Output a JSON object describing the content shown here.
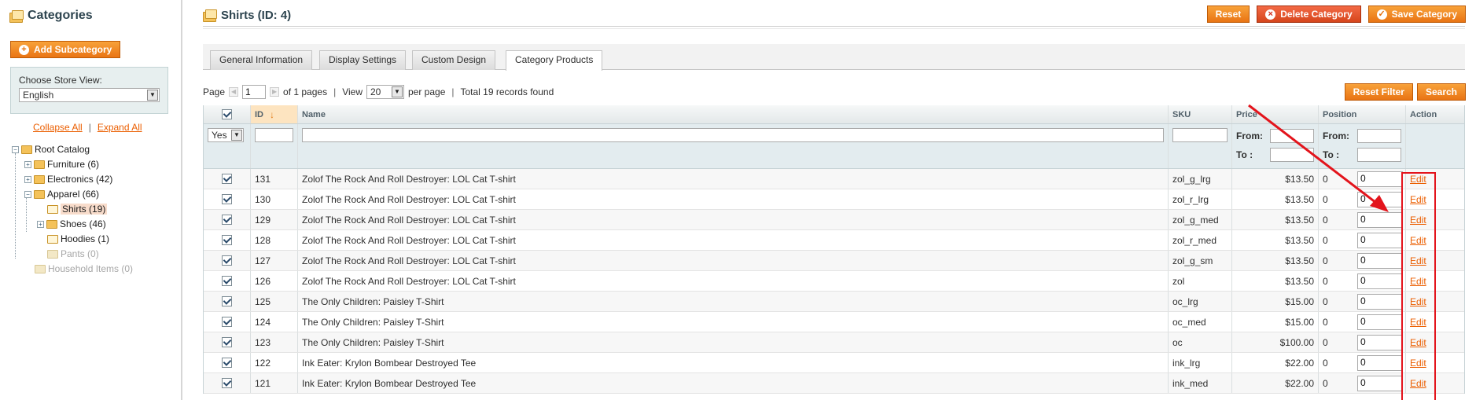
{
  "sidebar": {
    "title": "Categories",
    "add_subcategory": "Add Subcategory",
    "store_view_label": "Choose Store View:",
    "store_view_value": "English",
    "collapse_all": "Collapse All",
    "separator": "|",
    "expand_all": "Expand All",
    "tree": {
      "root": "Root Catalog",
      "furniture": "Furniture (6)",
      "electronics": "Electronics (42)",
      "apparel": "Apparel (66)",
      "shirts": "Shirts (19)",
      "shoes": "Shoes (46)",
      "hoodies": "Hoodies (1)",
      "pants": "Pants (0)",
      "household": "Household Items (0)"
    }
  },
  "header": {
    "title": "Shirts (ID: 4)",
    "reset": "Reset",
    "delete": "Delete Category",
    "save": "Save Category"
  },
  "tabs": [
    "General Information",
    "Display Settings",
    "Custom Design",
    "Category Products"
  ],
  "pager": {
    "page_label": "Page",
    "page_value": "1",
    "of_pages": "of 1 pages",
    "view_label": "View",
    "view_value": "20",
    "per_page": "per page",
    "total": "Total 19 records found",
    "reset_filter": "Reset Filter",
    "search": "Search"
  },
  "grid": {
    "headers": {
      "id": "ID",
      "name": "Name",
      "sku": "SKU",
      "price": "Price",
      "position": "Position",
      "action": "Action"
    },
    "filter": {
      "in_category": "Yes",
      "from": "From:",
      "to": "To :"
    },
    "rows": [
      {
        "id": "131",
        "name": "Zolof The Rock And Roll Destroyer: LOL Cat T-shirt",
        "sku": "zol_g_lrg",
        "price": "$13.50",
        "position": "0",
        "pos_input": "0",
        "action": "Edit"
      },
      {
        "id": "130",
        "name": "Zolof The Rock And Roll Destroyer: LOL Cat T-shirt",
        "sku": "zol_r_lrg",
        "price": "$13.50",
        "position": "0",
        "pos_input": "0",
        "action": "Edit"
      },
      {
        "id": "129",
        "name": "Zolof The Rock And Roll Destroyer: LOL Cat T-shirt",
        "sku": "zol_g_med",
        "price": "$13.50",
        "position": "0",
        "pos_input": "0",
        "action": "Edit"
      },
      {
        "id": "128",
        "name": "Zolof The Rock And Roll Destroyer: LOL Cat T-shirt",
        "sku": "zol_r_med",
        "price": "$13.50",
        "position": "0",
        "pos_input": "0",
        "action": "Edit"
      },
      {
        "id": "127",
        "name": "Zolof The Rock And Roll Destroyer: LOL Cat T-shirt",
        "sku": "zol_g_sm",
        "price": "$13.50",
        "position": "0",
        "pos_input": "0",
        "action": "Edit"
      },
      {
        "id": "126",
        "name": "Zolof The Rock And Roll Destroyer: LOL Cat T-shirt",
        "sku": "zol",
        "price": "$13.50",
        "position": "0",
        "pos_input": "0",
        "action": "Edit"
      },
      {
        "id": "125",
        "name": "The Only Children: Paisley T-Shirt",
        "sku": "oc_lrg",
        "price": "$15.00",
        "position": "0",
        "pos_input": "0",
        "action": "Edit"
      },
      {
        "id": "124",
        "name": "The Only Children: Paisley T-Shirt",
        "sku": "oc_med",
        "price": "$15.00",
        "position": "0",
        "pos_input": "0",
        "action": "Edit"
      },
      {
        "id": "123",
        "name": "The Only Children: Paisley T-Shirt",
        "sku": "oc",
        "price": "$100.00",
        "position": "0",
        "pos_input": "0",
        "action": "Edit"
      },
      {
        "id": "122",
        "name": "Ink Eater: Krylon Bombear Destroyed Tee",
        "sku": "ink_lrg",
        "price": "$22.00",
        "position": "0",
        "pos_input": "0",
        "action": "Edit"
      },
      {
        "id": "121",
        "name": "Ink Eater: Krylon Bombear Destroyed Tee",
        "sku": "ink_med",
        "price": "$22.00",
        "position": "0",
        "pos_input": "0",
        "action": "Edit"
      }
    ]
  },
  "colors": {
    "accent": "#eb5e00",
    "annotation": "#e3141c"
  },
  "icons": [
    "folder-stack-icon",
    "plus-circle-icon",
    "delete-icon",
    "save-icon",
    "sort-arrow-icon",
    "checkbox-icon",
    "dropdown-arrow-icon"
  ]
}
